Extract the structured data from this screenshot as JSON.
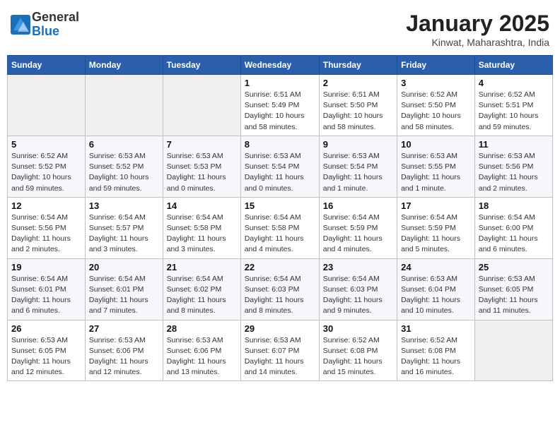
{
  "header": {
    "logo_line1": "General",
    "logo_line2": "Blue",
    "title": "January 2025",
    "subtitle": "Kinwat, Maharashtra, India"
  },
  "weekdays": [
    "Sunday",
    "Monday",
    "Tuesday",
    "Wednesday",
    "Thursday",
    "Friday",
    "Saturday"
  ],
  "weeks": [
    [
      {
        "day": "",
        "info": ""
      },
      {
        "day": "",
        "info": ""
      },
      {
        "day": "",
        "info": ""
      },
      {
        "day": "1",
        "info": "Sunrise: 6:51 AM\nSunset: 5:49 PM\nDaylight: 10 hours\nand 58 minutes."
      },
      {
        "day": "2",
        "info": "Sunrise: 6:51 AM\nSunset: 5:50 PM\nDaylight: 10 hours\nand 58 minutes."
      },
      {
        "day": "3",
        "info": "Sunrise: 6:52 AM\nSunset: 5:50 PM\nDaylight: 10 hours\nand 58 minutes."
      },
      {
        "day": "4",
        "info": "Sunrise: 6:52 AM\nSunset: 5:51 PM\nDaylight: 10 hours\nand 59 minutes."
      }
    ],
    [
      {
        "day": "5",
        "info": "Sunrise: 6:52 AM\nSunset: 5:52 PM\nDaylight: 10 hours\nand 59 minutes."
      },
      {
        "day": "6",
        "info": "Sunrise: 6:53 AM\nSunset: 5:52 PM\nDaylight: 10 hours\nand 59 minutes."
      },
      {
        "day": "7",
        "info": "Sunrise: 6:53 AM\nSunset: 5:53 PM\nDaylight: 11 hours\nand 0 minutes."
      },
      {
        "day": "8",
        "info": "Sunrise: 6:53 AM\nSunset: 5:54 PM\nDaylight: 11 hours\nand 0 minutes."
      },
      {
        "day": "9",
        "info": "Sunrise: 6:53 AM\nSunset: 5:54 PM\nDaylight: 11 hours\nand 1 minute."
      },
      {
        "day": "10",
        "info": "Sunrise: 6:53 AM\nSunset: 5:55 PM\nDaylight: 11 hours\nand 1 minute."
      },
      {
        "day": "11",
        "info": "Sunrise: 6:53 AM\nSunset: 5:56 PM\nDaylight: 11 hours\nand 2 minutes."
      }
    ],
    [
      {
        "day": "12",
        "info": "Sunrise: 6:54 AM\nSunset: 5:56 PM\nDaylight: 11 hours\nand 2 minutes."
      },
      {
        "day": "13",
        "info": "Sunrise: 6:54 AM\nSunset: 5:57 PM\nDaylight: 11 hours\nand 3 minutes."
      },
      {
        "day": "14",
        "info": "Sunrise: 6:54 AM\nSunset: 5:58 PM\nDaylight: 11 hours\nand 3 minutes."
      },
      {
        "day": "15",
        "info": "Sunrise: 6:54 AM\nSunset: 5:58 PM\nDaylight: 11 hours\nand 4 minutes."
      },
      {
        "day": "16",
        "info": "Sunrise: 6:54 AM\nSunset: 5:59 PM\nDaylight: 11 hours\nand 4 minutes."
      },
      {
        "day": "17",
        "info": "Sunrise: 6:54 AM\nSunset: 5:59 PM\nDaylight: 11 hours\nand 5 minutes."
      },
      {
        "day": "18",
        "info": "Sunrise: 6:54 AM\nSunset: 6:00 PM\nDaylight: 11 hours\nand 6 minutes."
      }
    ],
    [
      {
        "day": "19",
        "info": "Sunrise: 6:54 AM\nSunset: 6:01 PM\nDaylight: 11 hours\nand 6 minutes."
      },
      {
        "day": "20",
        "info": "Sunrise: 6:54 AM\nSunset: 6:01 PM\nDaylight: 11 hours\nand 7 minutes."
      },
      {
        "day": "21",
        "info": "Sunrise: 6:54 AM\nSunset: 6:02 PM\nDaylight: 11 hours\nand 8 minutes."
      },
      {
        "day": "22",
        "info": "Sunrise: 6:54 AM\nSunset: 6:03 PM\nDaylight: 11 hours\nand 8 minutes."
      },
      {
        "day": "23",
        "info": "Sunrise: 6:54 AM\nSunset: 6:03 PM\nDaylight: 11 hours\nand 9 minutes."
      },
      {
        "day": "24",
        "info": "Sunrise: 6:53 AM\nSunset: 6:04 PM\nDaylight: 11 hours\nand 10 minutes."
      },
      {
        "day": "25",
        "info": "Sunrise: 6:53 AM\nSunset: 6:05 PM\nDaylight: 11 hours\nand 11 minutes."
      }
    ],
    [
      {
        "day": "26",
        "info": "Sunrise: 6:53 AM\nSunset: 6:05 PM\nDaylight: 11 hours\nand 12 minutes."
      },
      {
        "day": "27",
        "info": "Sunrise: 6:53 AM\nSunset: 6:06 PM\nDaylight: 11 hours\nand 12 minutes."
      },
      {
        "day": "28",
        "info": "Sunrise: 6:53 AM\nSunset: 6:06 PM\nDaylight: 11 hours\nand 13 minutes."
      },
      {
        "day": "29",
        "info": "Sunrise: 6:53 AM\nSunset: 6:07 PM\nDaylight: 11 hours\nand 14 minutes."
      },
      {
        "day": "30",
        "info": "Sunrise: 6:52 AM\nSunset: 6:08 PM\nDaylight: 11 hours\nand 15 minutes."
      },
      {
        "day": "31",
        "info": "Sunrise: 6:52 AM\nSunset: 6:08 PM\nDaylight: 11 hours\nand 16 minutes."
      },
      {
        "day": "",
        "info": ""
      }
    ]
  ]
}
